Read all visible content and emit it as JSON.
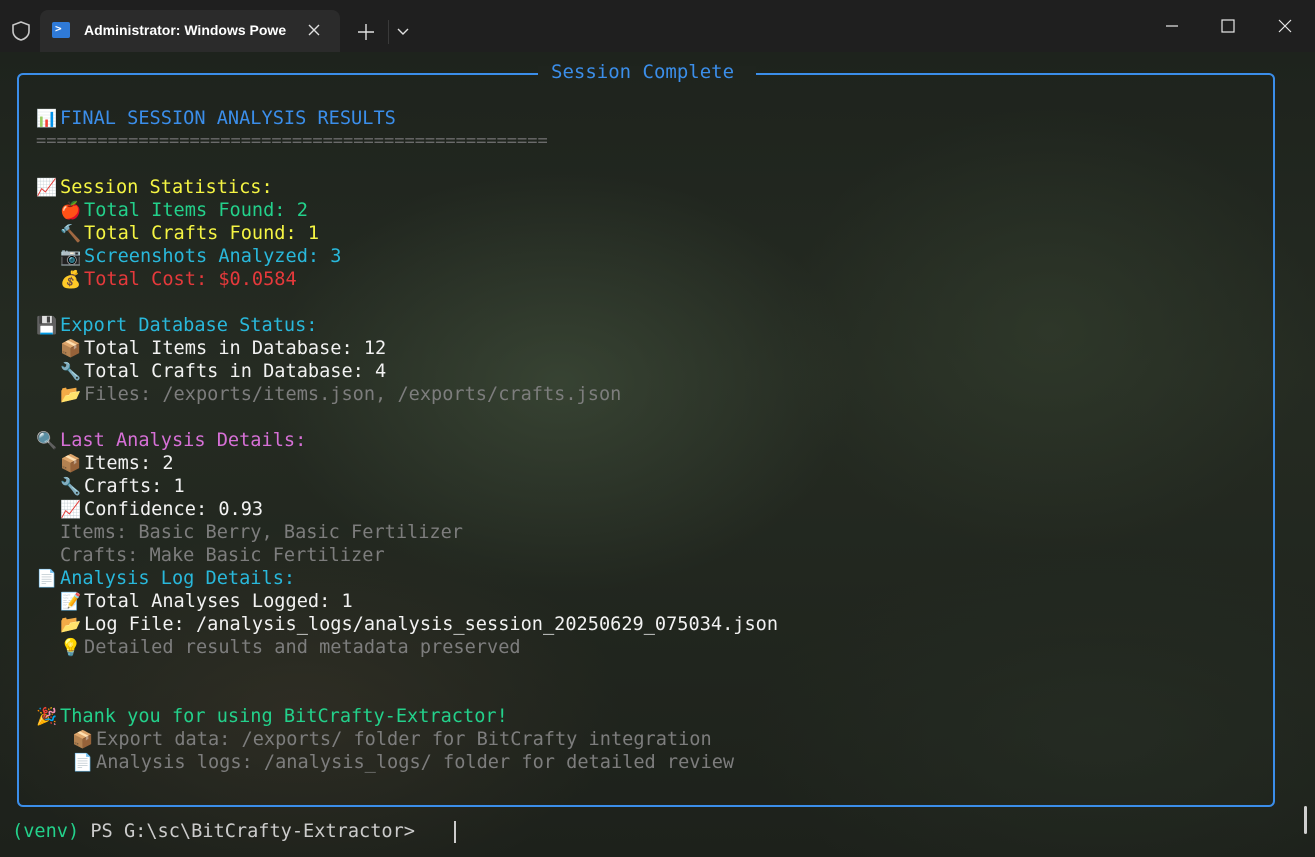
{
  "window": {
    "tab_title": "Administrator: Windows Powe",
    "tab_icon": "powershell-icon",
    "tab_icon_glyph": ">",
    "buttons": [
      "new-tab",
      "dropdown",
      "minimize",
      "maximize",
      "close"
    ]
  },
  "terminal": {
    "box_title": "Session Complete",
    "header": {
      "icon": "📊",
      "text": "FINAL SESSION ANALYSIS RESULTS"
    },
    "separator": "==================================================",
    "session_statistics": {
      "heading": {
        "icon": "📈",
        "text": "Session Statistics:"
      },
      "items": [
        {
          "icon": "🍎",
          "text": "Total Items Found: 2"
        },
        {
          "icon": "🔨",
          "text": "Total Crafts Found: 1"
        },
        {
          "icon": "📷",
          "text": "Screenshots Analyzed: 3"
        },
        {
          "icon": "💰",
          "text": "Total Cost: $0.0584"
        }
      ]
    },
    "export_status": {
      "heading": {
        "icon": "💾",
        "text": "Export Database Status:"
      },
      "items": [
        {
          "icon": "📦",
          "text": "Total Items in Database: 12"
        },
        {
          "icon": "🔧",
          "text": "Total Crafts in Database: 4"
        },
        {
          "icon": "📂",
          "text": "Files: /exports/items.json, /exports/crafts.json"
        }
      ]
    },
    "last_analysis": {
      "heading": {
        "icon": "🔍",
        "text": "Last Analysis Details:"
      },
      "items": [
        {
          "icon": "📦",
          "text": "Items: 2"
        },
        {
          "icon": "🔧",
          "text": "Crafts: 1"
        },
        {
          "icon": "📈",
          "text": "Confidence: 0.93"
        }
      ],
      "items_line": "Items: Basic Berry, Basic Fertilizer",
      "crafts_line": "Crafts: Make Basic Fertilizer"
    },
    "analysis_log": {
      "heading": {
        "icon": "📄",
        "text": "Analysis Log Details:"
      },
      "items": [
        {
          "icon": "📝",
          "text": "Total Analyses Logged: 1"
        },
        {
          "icon": "📂",
          "text": "Log File: /analysis_logs/analysis_session_20250629_075034.json"
        },
        {
          "icon": "💡",
          "text": "Detailed results and metadata preserved"
        }
      ]
    },
    "thanks": {
      "heading": {
        "icon": "🎉",
        "text": "Thank you for using BitCrafty-Extractor!"
      },
      "items": [
        {
          "icon": "📦",
          "text": "Export data: /exports/ folder for BitCrafty integration"
        },
        {
          "icon": "📄",
          "text": "Analysis logs: /analysis_logs/ folder for detailed review"
        }
      ]
    },
    "prompt": {
      "venv": "(venv)",
      "path": " PS G:\\sc\\BitCrafty-Extractor> "
    }
  },
  "colors": {
    "border": "#3b8eea",
    "yellow": "#f5f543",
    "green": "#23d18b",
    "cyan": "#29b8db",
    "red": "#e5393b",
    "magenta": "#d670d6",
    "gray": "#7d7d7d"
  }
}
